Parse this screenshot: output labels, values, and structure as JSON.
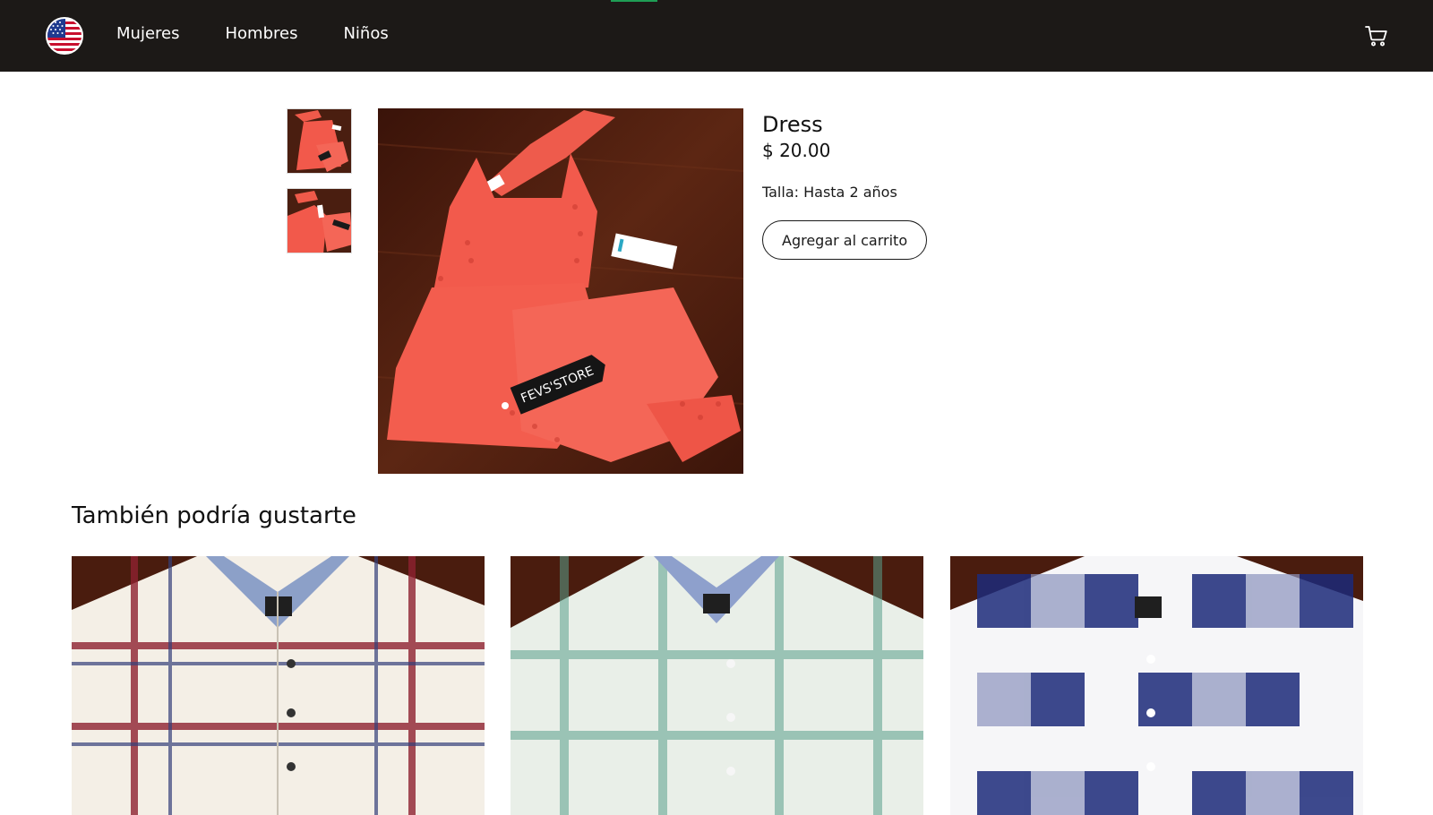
{
  "header": {
    "logo_icon": "us-flag-icon",
    "nav": [
      {
        "label": "Mujeres"
      },
      {
        "label": "Hombres"
      },
      {
        "label": "Niños"
      }
    ],
    "cart_icon": "cart-icon",
    "background_color": "#1c1917",
    "accent_strip_color": "#1f9d55"
  },
  "product": {
    "name": "Dress",
    "price": "$ 20.00",
    "size": "Talla: Hasta 2 años",
    "add_to_cart_label": "Agregar al carrito",
    "tag_text": "FEVS'STORE",
    "thumbnails": [
      {
        "name": "thumbnail-1"
      },
      {
        "name": "thumbnail-2"
      }
    ]
  },
  "related": {
    "title": "También podría gustarte",
    "items": [
      {
        "name": "related-product-1"
      },
      {
        "name": "related-product-2"
      },
      {
        "name": "related-product-3"
      }
    ]
  }
}
